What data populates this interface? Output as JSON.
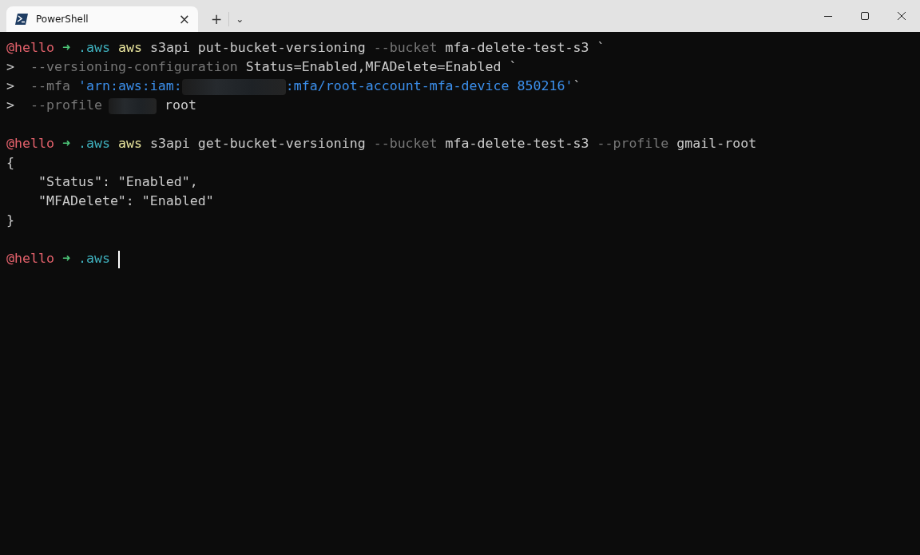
{
  "window": {
    "tabs": [
      {
        "title": "PowerShell",
        "selected": true,
        "close": "×"
      }
    ],
    "new_tab": "+",
    "dropdown": "⌄"
  },
  "terminal": {
    "blocks": [
      {
        "lines": [
          {
            "segments": [
              {
                "kind": "user",
                "text": "@hello"
              },
              {
                "kind": "arrow",
                "text": " ➜"
              },
              {
                "kind": "dir",
                "text": " .aws"
              },
              {
                "kind": "cmd",
                "text": " aws"
              },
              {
                "kind": "text",
                "text": " s3api put-bucket-versioning"
              },
              {
                "kind": "flag",
                "text": " --bucket"
              },
              {
                "kind": "text",
                "text": " mfa-delete-test-s3 `"
              }
            ]
          },
          {
            "segments": [
              {
                "kind": "text",
                "text": ">"
              },
              {
                "kind": "flag",
                "text": "  --versioning-configuration"
              },
              {
                "kind": "text",
                "text": " Status=Enabled,MFADelete=Enabled `"
              }
            ]
          },
          {
            "segments": [
              {
                "kind": "text",
                "text": ">"
              },
              {
                "kind": "flag",
                "text": "  --mfa"
              },
              {
                "kind": "string",
                "text": " 'arn:aws:iam:"
              },
              {
                "kind": "redacted_long"
              },
              {
                "kind": "string",
                "text": ":mfa/root-account-mfa-device 850216'"
              },
              {
                "kind": "text",
                "text": "`"
              }
            ]
          },
          {
            "segments": [
              {
                "kind": "text",
                "text": ">"
              },
              {
                "kind": "flag",
                "text": "  --profile"
              },
              {
                "kind": "redacted_short"
              },
              {
                "kind": "text",
                "text": "root"
              }
            ]
          }
        ]
      },
      {
        "lines": [
          {
            "segments": [
              {
                "kind": "user",
                "text": "@hello"
              },
              {
                "kind": "arrow",
                "text": " ➜"
              },
              {
                "kind": "dir",
                "text": " .aws"
              },
              {
                "kind": "cmd",
                "text": " aws"
              },
              {
                "kind": "text",
                "text": " s3api get-bucket-versioning"
              },
              {
                "kind": "flag",
                "text": " --bucket"
              },
              {
                "kind": "text",
                "text": " mfa-delete-test-s3"
              },
              {
                "kind": "flag",
                "text": " --profile"
              },
              {
                "kind": "text",
                "text": " gmail-root"
              }
            ]
          },
          {
            "segments": [
              {
                "kind": "text",
                "text": "{"
              }
            ]
          },
          {
            "segments": [
              {
                "kind": "text",
                "text": "    \"Status\": \"Enabled\","
              }
            ]
          },
          {
            "segments": [
              {
                "kind": "text",
                "text": "    \"MFADelete\": \"Enabled\""
              }
            ]
          },
          {
            "segments": [
              {
                "kind": "text",
                "text": "}"
              }
            ]
          }
        ]
      },
      {
        "lines": [
          {
            "segments": [
              {
                "kind": "user",
                "text": "@hello"
              },
              {
                "kind": "arrow",
                "text": " ➜"
              },
              {
                "kind": "dir",
                "text": " .aws"
              },
              {
                "kind": "cursor"
              }
            ]
          }
        ]
      }
    ]
  }
}
